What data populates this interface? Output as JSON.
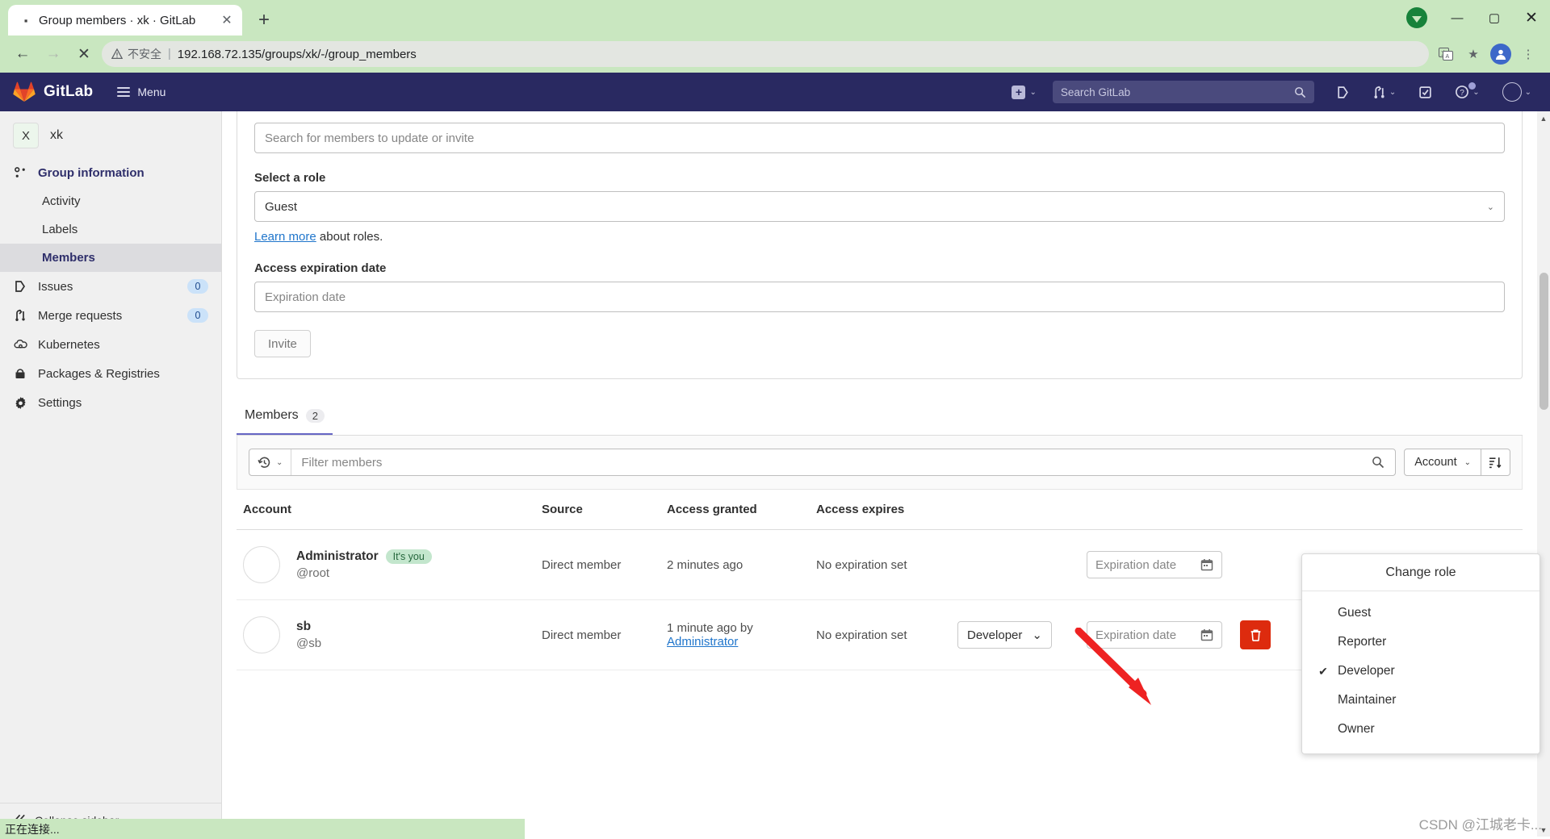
{
  "browser": {
    "tab_title": "Group members · xk · GitLab",
    "new_tab_label": "+",
    "back_label": "←",
    "forward_label": "→",
    "stop_label": "✕",
    "insecure_label": "不安全",
    "url": "192.168.72.135/groups/xk/-/group_members",
    "url_separator": "|",
    "minimize_label": "—",
    "maximize_label": "▢",
    "close_label": "✕"
  },
  "navbar": {
    "brand": "GitLab",
    "menu_label": "Menu",
    "search_placeholder": "Search GitLab"
  },
  "sidebar": {
    "group_initial": "X",
    "group_name": "xk",
    "items": [
      {
        "label": "Group information",
        "icon": "group-icon",
        "badge": null,
        "active": false,
        "sub": false
      },
      {
        "label": "Activity",
        "icon": null,
        "badge": null,
        "active": false,
        "sub": true
      },
      {
        "label": "Labels",
        "icon": null,
        "badge": null,
        "active": false,
        "sub": true
      },
      {
        "label": "Members",
        "icon": null,
        "badge": null,
        "active": true,
        "sub": true
      },
      {
        "label": "Issues",
        "icon": "issues-icon",
        "badge": "0",
        "active": false,
        "sub": false
      },
      {
        "label": "Merge requests",
        "icon": "merge-requests-icon",
        "badge": "0",
        "active": false,
        "sub": false
      },
      {
        "label": "Kubernetes",
        "icon": "kubernetes-icon",
        "badge": null,
        "active": false,
        "sub": false
      },
      {
        "label": "Packages & Registries",
        "icon": "packages-icon",
        "badge": null,
        "active": false,
        "sub": false
      },
      {
        "label": "Settings",
        "icon": "gear-icon",
        "badge": null,
        "active": false,
        "sub": false
      }
    ],
    "collapse_label": "Collapse sidebar"
  },
  "invite_form": {
    "search_placeholder": "Search for members to update or invite",
    "role_label": "Select a role",
    "role_value": "Guest",
    "learn_more_link": "Learn more",
    "learn_more_rest": " about roles.",
    "expiration_label": "Access expiration date",
    "expiration_placeholder": "Expiration date",
    "invite_button": "Invite"
  },
  "tabs": [
    {
      "label": "Members",
      "count": "2",
      "active": true
    }
  ],
  "filter_bar": {
    "filter_placeholder": "Filter members",
    "sort_label": "Account"
  },
  "members_table": {
    "columns": [
      "Account",
      "Source",
      "Access granted",
      "Access expires",
      "",
      "",
      ""
    ],
    "rows": [
      {
        "name": "Administrator",
        "badge": "It's you",
        "handle": "@root",
        "source": "Direct member",
        "granted": "2 minutes ago",
        "granted_by": null,
        "expires": "No expiration set",
        "role": null,
        "expiration_placeholder": "Expiration date",
        "has_delete": false
      },
      {
        "name": "sb",
        "badge": null,
        "handle": "@sb",
        "source": "Direct member",
        "granted": "1 minute ago by",
        "granted_by": "Administrator",
        "expires": "No expiration set",
        "role": "Developer",
        "expiration_placeholder": "Expiration date",
        "has_delete": true
      }
    ]
  },
  "role_dropdown": {
    "title": "Change role",
    "options": [
      {
        "label": "Guest",
        "checked": false
      },
      {
        "label": "Reporter",
        "checked": false
      },
      {
        "label": "Developer",
        "checked": true
      },
      {
        "label": "Maintainer",
        "checked": false
      },
      {
        "label": "Owner",
        "checked": false
      }
    ]
  },
  "status_bar": {
    "text": "正在连接..."
  },
  "watermark": {
    "text": "CSDN @江城老卡..."
  },
  "colors": {
    "gitlab_navy": "#292961",
    "accent_blue": "#1f75cb",
    "danger_red": "#dd2b0e",
    "tab_indicator": "#6666c4",
    "badge_green": "#c3e6cd",
    "arrow_red": "#ee2222"
  }
}
